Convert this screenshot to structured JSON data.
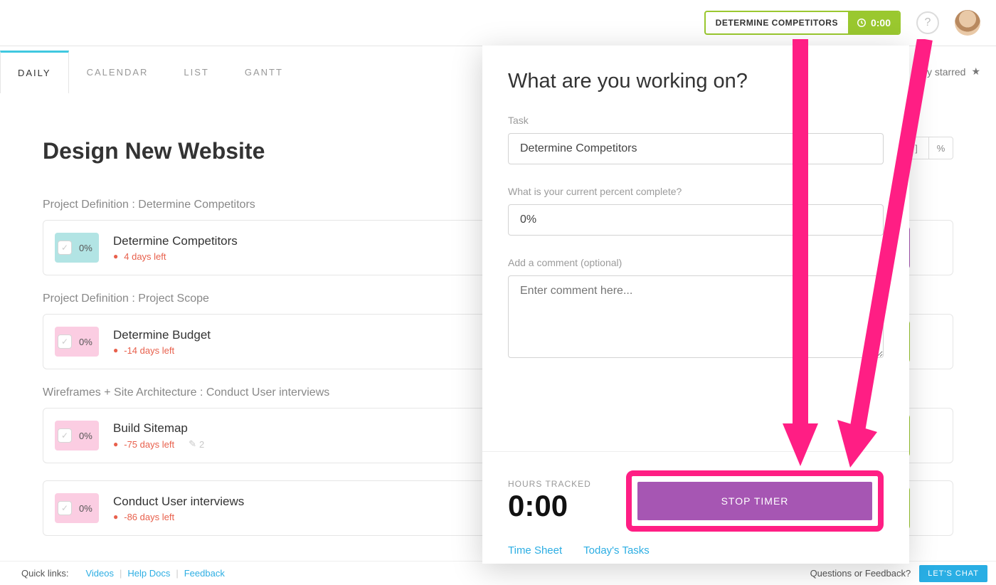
{
  "header": {
    "timer_chip": {
      "label": "DETERMINE COMPETITORS",
      "time": "0:00"
    }
  },
  "tabs": {
    "daily": "DAILY",
    "calendar": "CALENDAR",
    "list": "LIST",
    "gantt": "GANTT"
  },
  "toolbar": {
    "only_starred": "nly starred",
    "percent_btn": "%"
  },
  "page": {
    "title": "Design New Website"
  },
  "groups": [
    {
      "heading": "Project Definition : Determine Competitors",
      "task": {
        "pct": "0%",
        "title": "Determine Competitors",
        "due": "4 days left"
      },
      "tile": "purple"
    },
    {
      "heading": "Project Definition : Project Scope",
      "task": {
        "pct": "0%",
        "title": "Determine Budget",
        "due": "-14 days left"
      },
      "tile": "green"
    },
    {
      "heading": "Wireframes + Site Architecture : Conduct User interviews",
      "task": {
        "pct": "0%",
        "title": "Build Sitemap",
        "due": "-75 days left",
        "comments": "2"
      },
      "tile": "green"
    },
    {
      "heading": "",
      "task": {
        "pct": "0%",
        "title": "Conduct User interviews",
        "due": "-86 days left"
      },
      "tile": "green"
    }
  ],
  "modal": {
    "heading": "What are you working on?",
    "task_label": "Task",
    "task_value": "Determine Competitors",
    "pct_label": "What is your current percent complete?",
    "pct_value": "0%",
    "comment_label": "Add a comment (optional)",
    "comment_placeholder": "Enter comment here...",
    "hours_label": "HOURS TRACKED",
    "hours_value": "0:00",
    "stop_label": "STOP TIMER",
    "link_timesheet": "Time Sheet",
    "link_today": "Today's Tasks"
  },
  "footer": {
    "quick": "Quick links:",
    "videos": "Videos",
    "help": "Help Docs",
    "feedback": "Feedback",
    "question": "Questions or Feedback?",
    "chat": "LET'S CHAT"
  }
}
